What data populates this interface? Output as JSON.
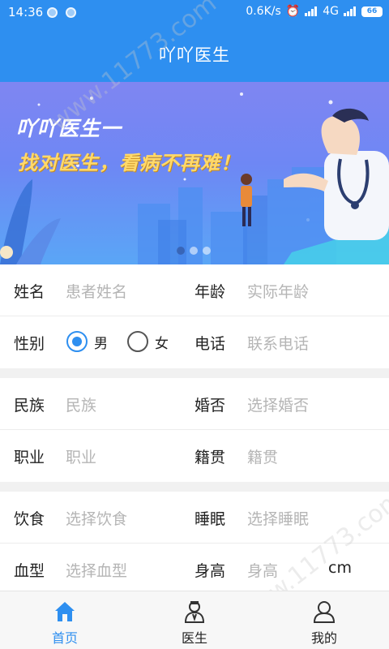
{
  "status_bar": {
    "time": "14:36",
    "network_speed": "0.6K/s",
    "network_type": "4G",
    "battery": "66"
  },
  "header": {
    "title": "吖吖医生"
  },
  "banner": {
    "title": "吖吖医生一",
    "subtitle": "找对医生，看病不再难！",
    "page_count": 3,
    "active_page": 1
  },
  "form": {
    "name": {
      "label": "姓名",
      "placeholder": "患者姓名"
    },
    "age": {
      "label": "年龄",
      "placeholder": "实际年龄"
    },
    "gender": {
      "label": "性别",
      "options": [
        "男",
        "女"
      ],
      "selected": "男"
    },
    "phone": {
      "label": "电话",
      "placeholder": "联系电话"
    },
    "ethnicity": {
      "label": "民族",
      "placeholder": "民族"
    },
    "marital": {
      "label": "婚否",
      "placeholder": "选择婚否"
    },
    "occupation": {
      "label": "职业",
      "placeholder": "职业"
    },
    "hometown": {
      "label": "籍贯",
      "placeholder": "籍贯"
    },
    "diet": {
      "label": "饮食",
      "placeholder": "选择饮食"
    },
    "sleep": {
      "label": "睡眠",
      "placeholder": "选择睡眠"
    },
    "blood_type": {
      "label": "血型",
      "placeholder": "选择血型"
    },
    "height": {
      "label": "身高",
      "placeholder": "身高",
      "unit": "cm"
    }
  },
  "tabbar": {
    "items": [
      {
        "label": "首页",
        "icon": "home-icon",
        "active": true
      },
      {
        "label": "医生",
        "icon": "doctor-icon",
        "active": false
      },
      {
        "label": "我的",
        "icon": "user-icon",
        "active": false
      }
    ]
  },
  "watermark": "www.11773.com",
  "colors": {
    "primary": "#2e8ff0",
    "placeholder": "#b5b5b5",
    "section_gap": "#f1f1f1"
  }
}
